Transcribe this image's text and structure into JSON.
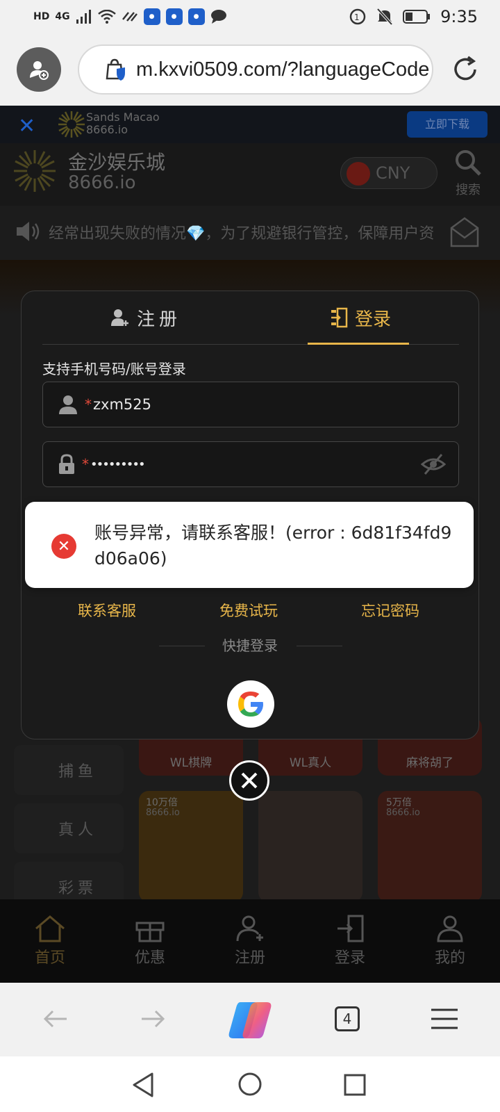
{
  "status_bar": {
    "left_icons": [
      "HD",
      "4G",
      "signal-icon",
      "wifi-icon",
      "sync-icon",
      "app-icon",
      "app-icon",
      "app-icon",
      "message-icon"
    ],
    "time": "9:35",
    "right_icons": [
      "data-saver-icon",
      "mute-icon",
      "battery-icon"
    ]
  },
  "browser": {
    "url": "m.kxvi0509.com/?languageCode",
    "tab_count": "4"
  },
  "site": {
    "promo": {
      "name": "Sands Macao",
      "domain": "8666.io",
      "download_label": "立即下载"
    },
    "brand": {
      "name": "金沙娱乐城",
      "domain": "8666.io"
    },
    "currency": "CNY",
    "search_label": "搜索",
    "ticker": "经常出现失败的情况💎，为了规避银行管控，保障用户资",
    "left_menu": [
      "捕鱼",
      "真人",
      "彩票"
    ],
    "tiles": [
      "WL棋牌",
      "WL真人",
      "麻将胡了"
    ],
    "tile_badges": [
      "10万倍",
      "5万倍"
    ],
    "tile_domain": "8666.io",
    "nav": [
      "首页",
      "优惠",
      "注册",
      "登录",
      "我的"
    ]
  },
  "modal": {
    "tab_register": "注册",
    "tab_login": "登录",
    "hint": "支持手机号码/账号登录",
    "username_value": "zxm525",
    "password_value": "•••••••••",
    "required_mark": "*",
    "link_support": "联系客服",
    "link_trial": "免费试玩",
    "link_forgot": "忘记密码",
    "quick_login": "快捷登录"
  },
  "toast": {
    "message": "账号异常，请联系客服！(error : 6d81f34fd9d06a06)"
  },
  "colors": {
    "accent_gold": "#e8b64a",
    "error_red": "#e63a33",
    "browser_bg": "#f1f1f1"
  }
}
